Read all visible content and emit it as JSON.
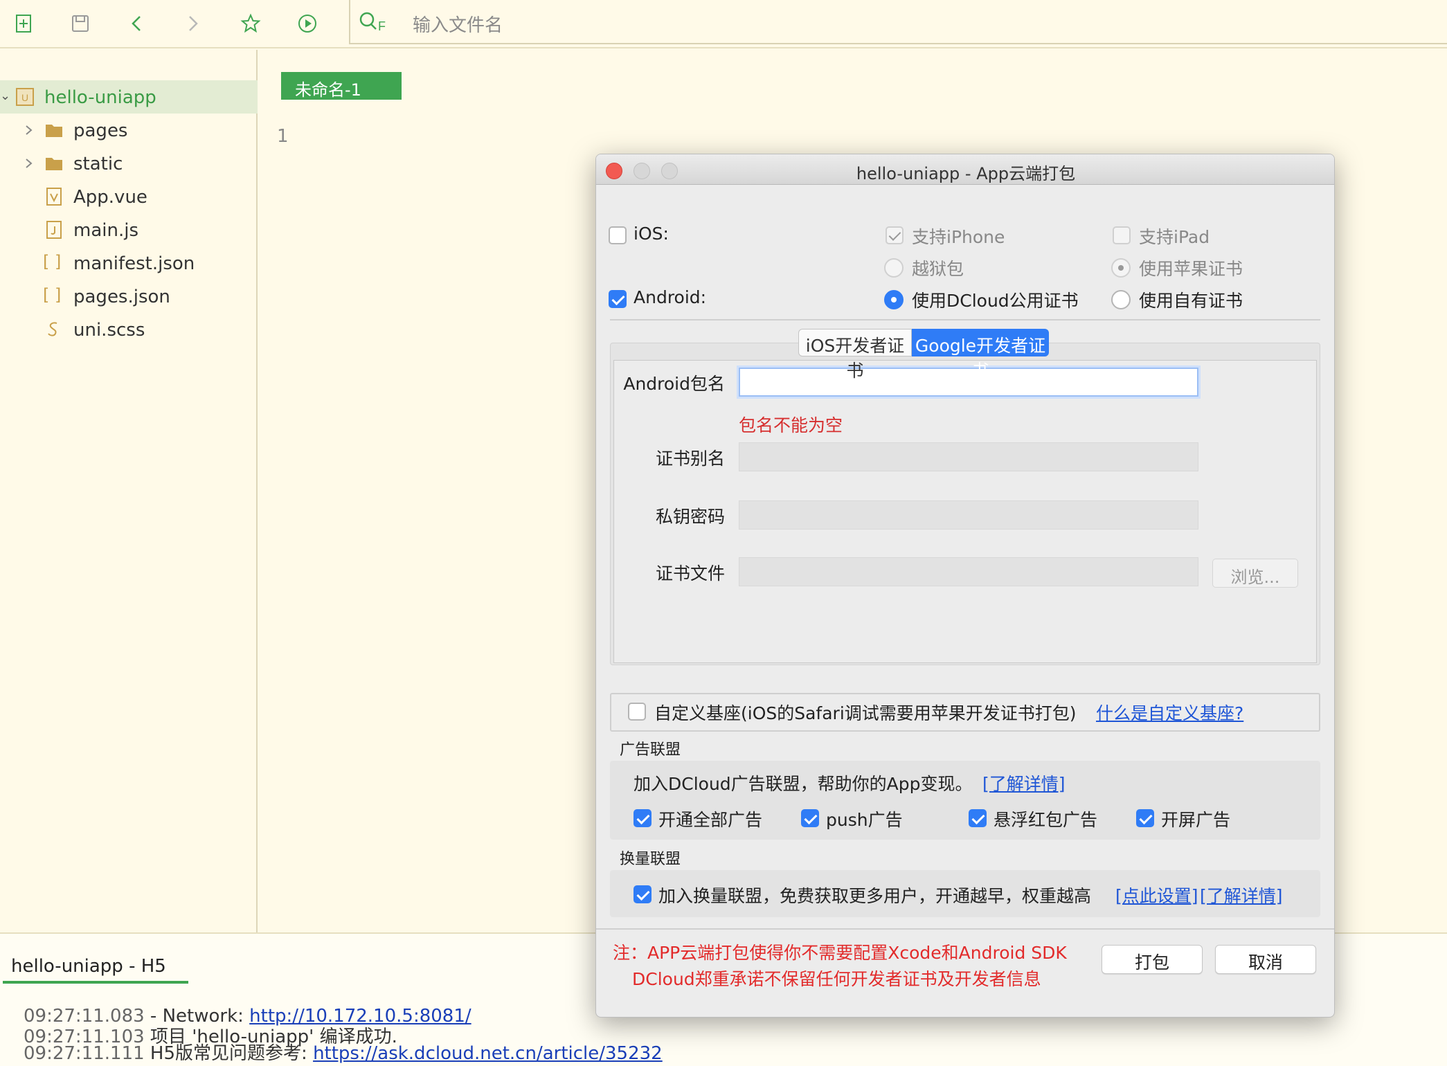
{
  "toolbar": {
    "icons": [
      "new-file-icon",
      "save-icon",
      "back-icon",
      "forward-icon",
      "star-icon",
      "run-icon",
      "file-search-icon"
    ],
    "search_placeholder": "输入文件名",
    "search_icon_letter": "F"
  },
  "sidebar": {
    "root": {
      "label": "hello-uniapp",
      "icon": "project-icon"
    },
    "items": [
      {
        "label": "pages",
        "icon": "folder-icon",
        "expandable": true
      },
      {
        "label": "static",
        "icon": "folder-icon",
        "expandable": true
      },
      {
        "label": "App.vue",
        "icon": "vue-file-icon"
      },
      {
        "label": "main.js",
        "icon": "js-file-icon"
      },
      {
        "label": "manifest.json",
        "icon": "json-file-icon"
      },
      {
        "label": "pages.json",
        "icon": "json-file-icon"
      },
      {
        "label": "uni.scss",
        "icon": "scss-file-icon"
      }
    ],
    "json_glyph": "[ ]"
  },
  "editor": {
    "tab_label": "未命名-1",
    "line_number": "1"
  },
  "console": {
    "tab_label": "hello-uniapp - H5",
    "lines": [
      {
        "time": "09:27:11.083",
        "text": "  - Network: ",
        "link": "http://10.172.10.5:8081/"
      },
      {
        "time": "09:27:11.103",
        "text": " 项目 'hello-uniapp' 编译成功.",
        "link": ""
      },
      {
        "time": "09:27:11.111",
        "text": " H5版常见问题参考: ",
        "link": "https://ask.dcloud.net.cn/article/35232"
      }
    ]
  },
  "dialog": {
    "title": "hello-uniapp - App云端打包",
    "ios": {
      "label": "iOS:",
      "checked": false
    },
    "android": {
      "label": "Android:",
      "checked": true
    },
    "support_iphone": "支持iPhone",
    "support_ipad": "支持iPad",
    "jailbreak": "越狱包",
    "use_apple_cert": "使用苹果证书",
    "use_dcloud_cert": "使用DCloud公用证书",
    "use_own_cert": "使用自有证书",
    "tabs": {
      "ios": "iOS开发者证书",
      "google": "Google开发者证书"
    },
    "form": {
      "package_label": "Android包名",
      "package_value": "",
      "package_error": "包名不能为空",
      "alias_label": "证书别名",
      "password_label": "私钥密码",
      "file_label": "证书文件",
      "browse": "浏览..."
    },
    "custom_base": {
      "label": "自定义基座(iOS的Safari调试需要用苹果开发证书打包)",
      "link": "什么是自定义基座?",
      "checked": false
    },
    "ad_union": {
      "title": "广告联盟",
      "desc": "加入DCloud广告联盟，帮助你的App变现。",
      "link": "[了解详情]",
      "options": [
        {
          "label": "开通全部广告",
          "checked": true
        },
        {
          "label": "push广告",
          "checked": true
        },
        {
          "label": "悬浮红包广告",
          "checked": true
        },
        {
          "label": "开屏广告",
          "checked": true
        }
      ]
    },
    "exchange_union": {
      "title": "换量联盟",
      "label": "加入换量联盟，免费获取更多用户，开通越早，权重越高",
      "link_settings": "[点此设置]",
      "link_details": "[了解详情]",
      "checked": true
    },
    "note_line1": "注：APP云端打包使得你不需要配置Xcode和Android SDK",
    "note_line2": "DCloud郑重承诺不保留任何开发者证书及开发者信息",
    "buttons": {
      "pack": "打包",
      "cancel": "取消"
    }
  },
  "colors": {
    "accent_green": "#3fa551",
    "selection_blue": "#2f7cf6",
    "error_red": "#d62f2f",
    "link_blue": "#1f56d6",
    "background": "#fffae8"
  }
}
